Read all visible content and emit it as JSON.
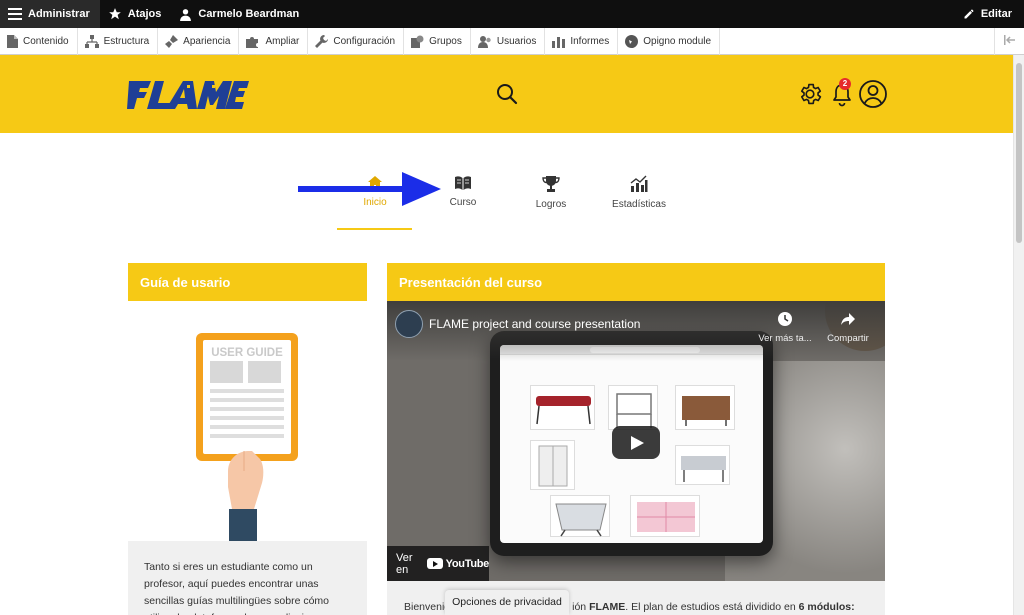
{
  "admin_bar": {
    "menu_label": "Administrar",
    "shortcuts_label": "Atajos",
    "user_label": "Carmelo Beardman",
    "edit_label": "Editar"
  },
  "tray": {
    "items": [
      {
        "label": "Contenido",
        "icon": "file-icon"
      },
      {
        "label": "Estructura",
        "icon": "structure-icon"
      },
      {
        "label": "Apariencia",
        "icon": "brush-icon"
      },
      {
        "label": "Ampliar",
        "icon": "puzzle-icon"
      },
      {
        "label": "Configuración",
        "icon": "wrench-icon"
      },
      {
        "label": "Grupos",
        "icon": "groups-icon"
      },
      {
        "label": "Usuarios",
        "icon": "users-icon"
      },
      {
        "label": "Informes",
        "icon": "reports-icon"
      },
      {
        "label": "Opigno module",
        "icon": "opigno-icon"
      }
    ]
  },
  "header": {
    "logo_text": "FLAME",
    "notification_count": "2",
    "brand_color": "#f6c915"
  },
  "nav": {
    "tabs": [
      {
        "label": "Inicio",
        "icon": "home-icon",
        "active": true
      },
      {
        "label": "Curso",
        "icon": "book-icon",
        "active": false
      },
      {
        "label": "Logros",
        "icon": "trophy-icon",
        "active": false
      },
      {
        "label": "Estadísticas",
        "icon": "stats-icon",
        "active": false
      }
    ]
  },
  "guide_card": {
    "title": "Guía de usario",
    "image_text": "USER GUIDE",
    "text": "Tanto si eres un estudiante como un profesor, aquí puedes encontrar unas sencillas guías multilingües sobre cómo utilizar la plataforma de aprendizaje electrónico y sacar el máximo"
  },
  "course_card": {
    "title": "Presentación del curso",
    "video_title": "FLAME project and course presentation",
    "watch_later": "Ver más ta...",
    "share": "Compartir",
    "watch_on": "Ver en",
    "youtube": "YouTube",
    "intro_prefix": "Bienvenid",
    "intro_mid": "ión ",
    "intro_brand": "FLAME",
    "intro_rest": ". El plan de estudios está dividido en ",
    "intro_modules": "6 módulos:"
  },
  "privacy_label": "Opciones de privacidad"
}
